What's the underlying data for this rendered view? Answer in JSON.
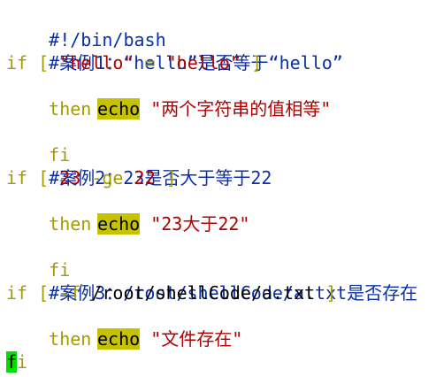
{
  "editor": {
    "colors": {
      "background": "#ffffff",
      "comment": "#0b2fa8",
      "keyword": "#a59a00",
      "string": "#b00000",
      "echo_highlight": "#c6c200",
      "cursor": "#00e000"
    },
    "lines": {
      "l1": "#!/bin/bash",
      "l2": "#案例1：“hello”是否等于“hello”",
      "l3_if": "if",
      "l3_lb": " [ ",
      "l3_s1": "\"hello\"",
      "l3_eq": " = ",
      "l3_s2": "\"hello\"",
      "l3_rb": " ]",
      "l4": "then",
      "l5_echo": "echo",
      "l5_str": "\"两个字符串的值相等\"",
      "l6": "fi",
      "l7": "#案例2：23是否大于等于22",
      "l8_if": "if",
      "l8_lb": " [ ",
      "l8_n1": "23",
      "l8_op": " -ge ",
      "l8_n2": "22",
      "l8_rb": " ]",
      "l9": "then",
      "l10_echo": "echo",
      "l10_str": "\"23大于22\"",
      "l11": "fi",
      "l12": "#案例3：/root/shellCode/a.txt是否存在",
      "l13_if": "if",
      "l13_lb": " [ ",
      "l13_op": "-f",
      "l13_path": " /root/shellCode/a.txt ",
      "l13_rb": "]",
      "l14": "then",
      "l15_echo": "echo",
      "l15_str": "\"文件存在\"",
      "l16_cursor": "f",
      "l16_rest": "i"
    }
  }
}
